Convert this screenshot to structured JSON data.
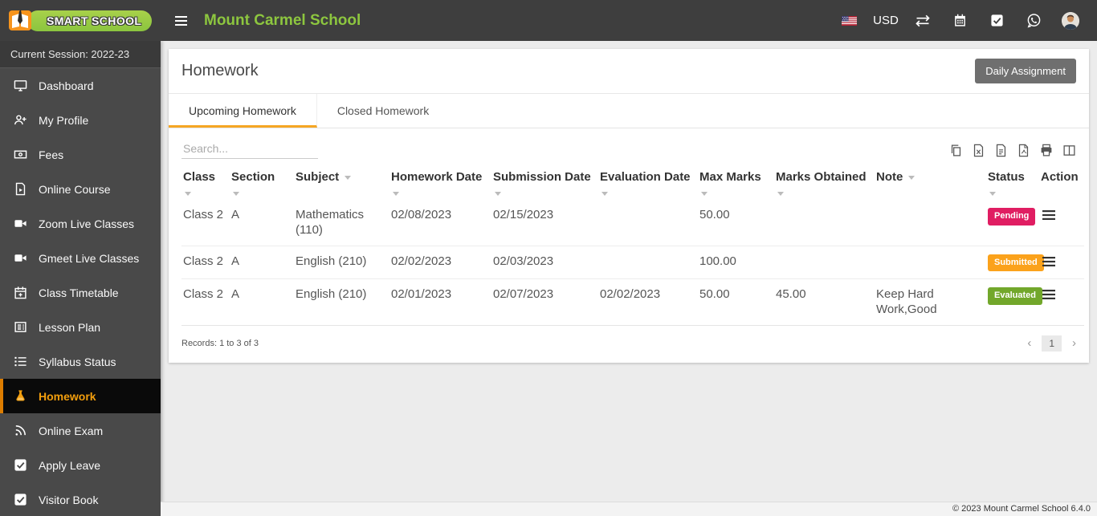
{
  "navbar": {
    "brand": "SMART SCHOOL",
    "title": "Mount Carmel School",
    "currency": "USD",
    "icons": [
      "hamburger-menu-icon",
      "us-flag-icon",
      "swap-arrows-icon",
      "calendar-icon",
      "task-check-icon",
      "whatsapp-icon",
      "avatar"
    ]
  },
  "sidebar": {
    "session_label": "Current Session: 2022-23",
    "items": [
      {
        "label": "Dashboard",
        "icon": "monitor-icon",
        "active": false
      },
      {
        "label": "My Profile",
        "icon": "user-plus-icon",
        "active": false
      },
      {
        "label": "Fees",
        "icon": "money-icon",
        "active": false
      },
      {
        "label": "Online Course",
        "icon": "file-video-icon",
        "active": false
      },
      {
        "label": "Zoom Live Classes",
        "icon": "video-camera-icon",
        "active": false
      },
      {
        "label": "Gmeet Live Classes",
        "icon": "video-camera-icon",
        "active": false
      },
      {
        "label": "Class Timetable",
        "icon": "calendar-plus-icon",
        "active": false
      },
      {
        "label": "Lesson Plan",
        "icon": "lesson-plan-icon",
        "active": false
      },
      {
        "label": "Syllabus Status",
        "icon": "list-icon",
        "active": false
      },
      {
        "label": "Homework",
        "icon": "flask-icon",
        "active": true
      },
      {
        "label": "Online Exam",
        "icon": "rss-icon",
        "active": false
      },
      {
        "label": "Apply Leave",
        "icon": "check-square-icon",
        "active": false
      },
      {
        "label": "Visitor Book",
        "icon": "check-square-icon",
        "active": false
      }
    ]
  },
  "main": {
    "page_title": "Homework",
    "daily_assignment_button": "Daily Assignment",
    "tabs": [
      {
        "label": "Upcoming Homework",
        "active": true
      },
      {
        "label": "Closed Homework",
        "active": false
      }
    ],
    "search_placeholder": "Search...",
    "export_icons": [
      "copy-icon",
      "excel-export-icon",
      "csv-export-icon",
      "pdf-export-icon",
      "print-icon",
      "column-visibility-icon"
    ],
    "table": {
      "columns": [
        "Class",
        "Section",
        "Subject",
        "Homework Date",
        "Submission Date",
        "Evaluation Date",
        "Max Marks",
        "Marks Obtained",
        "Note",
        "Status",
        "Action"
      ],
      "rows": [
        {
          "class": "Class 2",
          "section": "A",
          "subject": "Mathematics (110)",
          "homework_date": "02/08/2023",
          "submission_date": "02/15/2023",
          "evaluation_date": "",
          "max_marks": "50.00",
          "marks_obtained": "",
          "note": "",
          "status": "Pending",
          "status_color": "#E01D62"
        },
        {
          "class": "Class 2",
          "section": "A",
          "subject": "English (210)",
          "homework_date": "02/02/2023",
          "submission_date": "02/03/2023",
          "evaluation_date": "",
          "max_marks": "100.00",
          "marks_obtained": "",
          "note": "",
          "status": "Submitted",
          "status_color": "#FBA21B"
        },
        {
          "class": "Class 2",
          "section": "A",
          "subject": "English (210)",
          "homework_date": "02/01/2023",
          "submission_date": "02/07/2023",
          "evaluation_date": "02/02/2023",
          "max_marks": "50.00",
          "marks_obtained": "45.00",
          "note": "Keep Hard Work,Good",
          "status": "Evaluated",
          "status_color": "#72A72B"
        }
      ],
      "records_text": "Records: 1 to 3 of 3",
      "pagination": {
        "prev": "‹",
        "current_page": "1",
        "next": "›"
      }
    }
  },
  "footer": {
    "copyright": "© 2023 Mount Carmel School 6.4.0"
  },
  "colors": {
    "brand_green": "#8DC63F",
    "accent_orange": "#F5A623",
    "active_item_orange": "#F29E0D",
    "status_pending": "#E01D62",
    "status_submitted": "#FBA21B",
    "status_evaluated": "#72A72B"
  }
}
